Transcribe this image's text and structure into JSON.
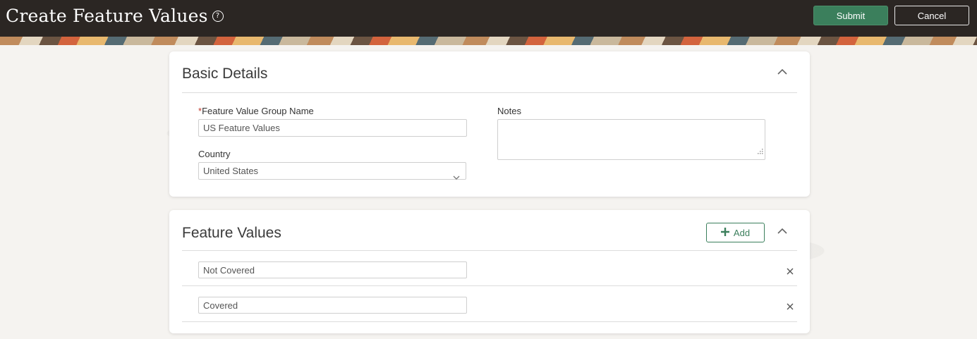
{
  "header": {
    "title": "Create Feature Values",
    "help_icon": "help-circle-icon",
    "submit_label": "Submit",
    "cancel_label": "Cancel",
    "submit_color": "#3b7f5c"
  },
  "basic_details": {
    "title": "Basic Details",
    "feature_value_group_name": {
      "required_marker": "*",
      "label": "Feature Value Group Name",
      "value": "US Feature Values"
    },
    "country": {
      "label": "Country",
      "value": "United States"
    },
    "notes": {
      "label": "Notes",
      "value": ""
    }
  },
  "feature_values": {
    "title": "Feature Values",
    "add_label": "Add",
    "rows": [
      {
        "value": "Not Covered"
      },
      {
        "value": "Covered"
      }
    ]
  }
}
